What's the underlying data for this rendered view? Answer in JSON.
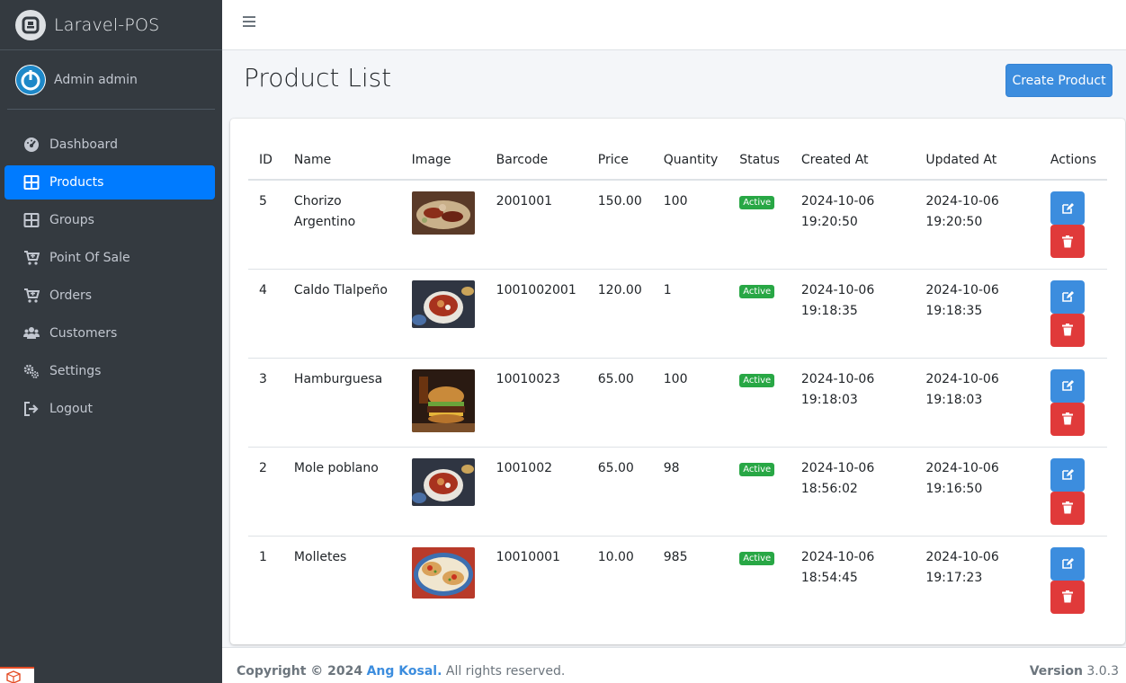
{
  "brand": {
    "name": "Laravel-POS"
  },
  "user": {
    "name": "Admin admin"
  },
  "nav": [
    {
      "label": "Dashboard",
      "icon": "dashboard-icon",
      "active": false
    },
    {
      "label": "Products",
      "icon": "table-icon",
      "active": true
    },
    {
      "label": "Groups",
      "icon": "table-icon",
      "active": false
    },
    {
      "label": "Point Of Sale",
      "icon": "cart-plus-icon",
      "active": false
    },
    {
      "label": "Orders",
      "icon": "cart-icon",
      "active": false
    },
    {
      "label": "Customers",
      "icon": "users-icon",
      "active": false
    },
    {
      "label": "Settings",
      "icon": "gears-icon",
      "active": false
    },
    {
      "label": "Logout",
      "icon": "logout-icon",
      "active": false
    }
  ],
  "page": {
    "title": "Product List",
    "create_label": "Create Product"
  },
  "table": {
    "columns": [
      "ID",
      "Name",
      "Image",
      "Barcode",
      "Price",
      "Quantity",
      "Status",
      "Created At",
      "Updated At",
      "Actions"
    ],
    "rows": [
      {
        "id": "5",
        "name": "Chorizo Argentino",
        "barcode": "2001001",
        "price": "150.00",
        "quantity": "100",
        "status": "Active",
        "created": "2024-10-06 19:20:50",
        "updated": "2024-10-06 19:20:50",
        "image": "chorizo-image"
      },
      {
        "id": "4",
        "name": "Caldo Tlalpeño",
        "barcode": "1001002001",
        "price": "120.00",
        "quantity": "1",
        "status": "Active",
        "created": "2024-10-06 19:18:35",
        "updated": "2024-10-06 19:18:35",
        "image": "soup-image"
      },
      {
        "id": "3",
        "name": "Hamburguesa",
        "barcode": "10010023",
        "price": "65.00",
        "quantity": "100",
        "status": "Active",
        "created": "2024-10-06 19:18:03",
        "updated": "2024-10-06 19:18:03",
        "image": "burger-image"
      },
      {
        "id": "2",
        "name": "Mole poblano",
        "barcode": "1001002",
        "price": "65.00",
        "quantity": "98",
        "status": "Active",
        "created": "2024-10-06 18:56:02",
        "updated": "2024-10-06 19:16:50",
        "image": "soup-image"
      },
      {
        "id": "1",
        "name": "Molletes",
        "barcode": "10010001",
        "price": "10.00",
        "quantity": "985",
        "status": "Active",
        "created": "2024-10-06 18:54:45",
        "updated": "2024-10-06 19:17:23",
        "image": "molletes-image"
      }
    ]
  },
  "footer": {
    "copyright": "Copyright © 2024",
    "author": "Ang Kosal.",
    "rights": "All rights reserved.",
    "version_label": "Version",
    "version": "3.0.3"
  },
  "colors": {
    "sidebar": "#343a40",
    "primary": "#007bff",
    "edit": "#3c8dde",
    "delete": "#e03a3a",
    "status": "#28a745"
  }
}
